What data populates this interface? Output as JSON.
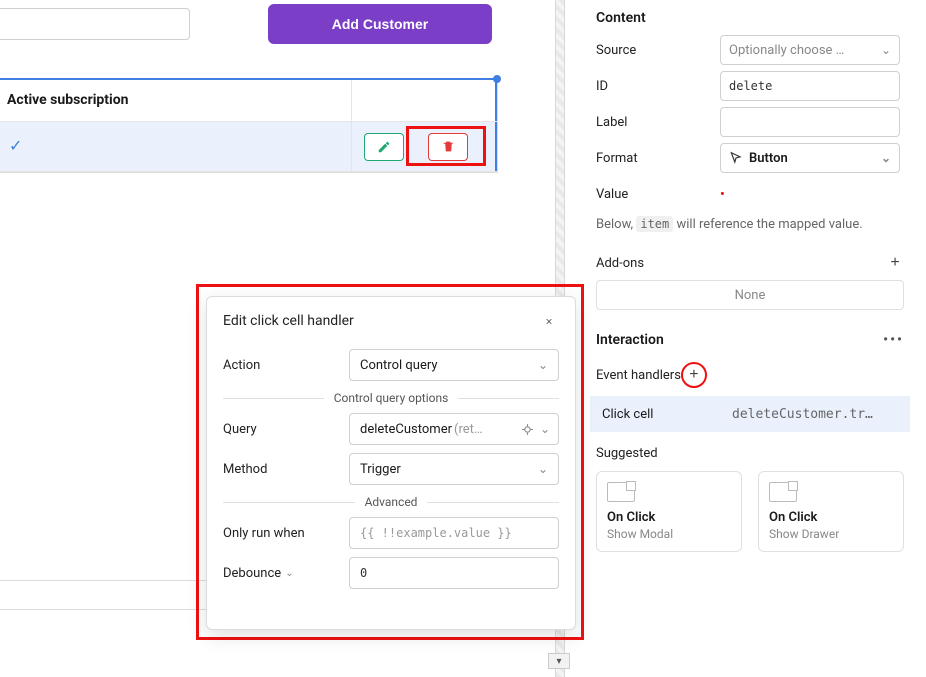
{
  "main": {
    "add_button": "Add Customer",
    "column_header": "Active subscription"
  },
  "panel": {
    "content_title": "Content",
    "source_label": "Source",
    "source_placeholder": "Optionally choose …",
    "id_label": "ID",
    "id_value": "delete",
    "label_label": "Label",
    "label_value": "",
    "format_label": "Format",
    "format_value": "Button",
    "value_label": "Value",
    "value_indicator": "•",
    "helper_prefix": "Below, ",
    "helper_code": "item",
    "helper_suffix": " will reference the mapped value.",
    "addons_label": "Add-ons",
    "none_text": "None",
    "interaction_title": "Interaction",
    "event_handlers_label": "Event handlers",
    "handler_event": "Click cell",
    "handler_value": "deleteCustomer.tr…",
    "suggested_label": "Suggested",
    "sugg1_title": "On Click",
    "sugg1_sub": "Show Modal",
    "sugg2_title": "On Click",
    "sugg2_sub": "Show Drawer"
  },
  "popover": {
    "title": "Edit click cell handler",
    "action_label": "Action",
    "action_value": "Control query",
    "options_divider": "Control query options",
    "query_label": "Query",
    "query_value": "deleteCustomer",
    "query_suffix": "(ret…",
    "method_label": "Method",
    "method_value": "Trigger",
    "advanced_divider": "Advanced",
    "only_run_label": "Only run when",
    "only_run_placeholder": "{{ !!example.value }}",
    "debounce_label": "Debounce",
    "debounce_value": "0"
  }
}
